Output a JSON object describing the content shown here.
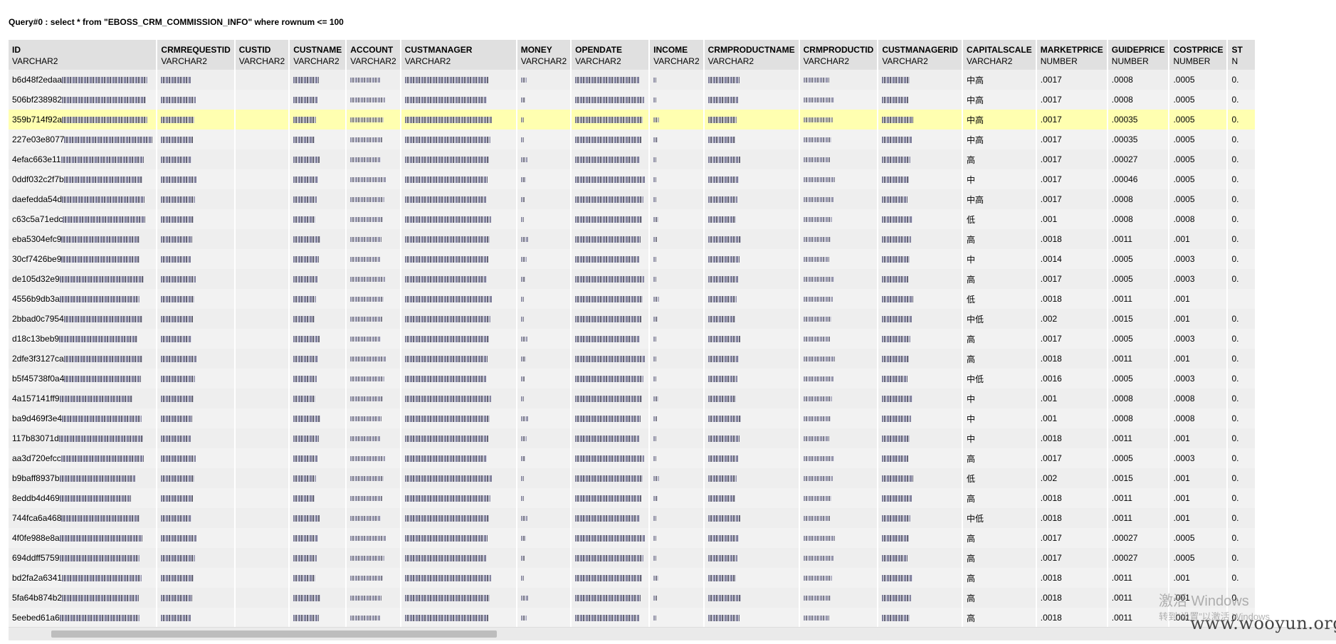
{
  "query_title": "Query#0 : select * from \"EBOSS_CRM_COMMISSION_INFO\" where rownum <= 100",
  "columns": [
    {
      "name": "ID",
      "type": "VARCHAR2"
    },
    {
      "name": "CRMREQUESTID",
      "type": "VARCHAR2"
    },
    {
      "name": "CUSTID",
      "type": "VARCHAR2"
    },
    {
      "name": "CUSTNAME",
      "type": "VARCHAR2"
    },
    {
      "name": "ACCOUNT",
      "type": "VARCHAR2"
    },
    {
      "name": "CUSTMANAGER",
      "type": "VARCHAR2"
    },
    {
      "name": "MONEY",
      "type": "VARCHAR2"
    },
    {
      "name": "OPENDATE",
      "type": "VARCHAR2"
    },
    {
      "name": "INCOME",
      "type": "VARCHAR2"
    },
    {
      "name": "CRMPRODUCTNAME",
      "type": "VARCHAR2"
    },
    {
      "name": "CRMPRODUCTID",
      "type": "VARCHAR2"
    },
    {
      "name": "CUSTMANAGERID",
      "type": "VARCHAR2"
    },
    {
      "name": "CAPITALSCALE",
      "type": "VARCHAR2"
    },
    {
      "name": "MARKETPRICE",
      "type": "NUMBER"
    },
    {
      "name": "GUIDEPRICE",
      "type": "NUMBER"
    },
    {
      "name": "COSTPRICE",
      "type": "NUMBER"
    },
    {
      "name": "ST",
      "type": "N"
    }
  ],
  "rows": [
    {
      "id": "b6d48f2edaa",
      "capitalscale": "中高",
      "marketprice": ".0017",
      "guideprice": ".0008",
      "costprice": ".0005",
      "st": "0."
    },
    {
      "id": "506bf238982",
      "capitalscale": "中高",
      "marketprice": ".0017",
      "guideprice": ".0008",
      "costprice": ".0005",
      "st": "0."
    },
    {
      "id": "359b714f92a",
      "capitalscale": "中高",
      "marketprice": ".0017",
      "guideprice": ".00035",
      "costprice": ".0005",
      "st": "0."
    },
    {
      "id": "227e03e8077",
      "capitalscale": "中高",
      "marketprice": ".0017",
      "guideprice": ".00035",
      "costprice": ".0005",
      "st": "0."
    },
    {
      "id": "4efac663e11",
      "capitalscale": "高",
      "marketprice": ".0017",
      "guideprice": ".00027",
      "costprice": ".0005",
      "st": "0."
    },
    {
      "id": "0ddf032c2f7b",
      "capitalscale": "中",
      "marketprice": ".0017",
      "guideprice": ".00046",
      "costprice": ".0005",
      "st": "0."
    },
    {
      "id": "daefedda54d",
      "capitalscale": "中高",
      "marketprice": ".0017",
      "guideprice": ".0008",
      "costprice": ".0005",
      "st": "0."
    },
    {
      "id": "c63c5a71edc",
      "capitalscale": "低",
      "marketprice": ".001",
      "guideprice": ".0008",
      "costprice": ".0008",
      "st": "0."
    },
    {
      "id": "eba5304efc9",
      "capitalscale": "高",
      "marketprice": ".0018",
      "guideprice": ".0011",
      "costprice": ".001",
      "st": "0."
    },
    {
      "id": "30cf7426be9",
      "capitalscale": "中",
      "marketprice": ".0014",
      "guideprice": ".0005",
      "costprice": ".0003",
      "st": "0."
    },
    {
      "id": "de105d32e9",
      "capitalscale": "高",
      "marketprice": ".0017",
      "guideprice": ".0005",
      "costprice": ".0003",
      "st": "0."
    },
    {
      "id": "4556b9db3a",
      "capitalscale": "低",
      "marketprice": ".0018",
      "guideprice": ".0011",
      "costprice": ".001",
      "st": ""
    },
    {
      "id": "2bbad0c7954",
      "capitalscale": "中低",
      "marketprice": ".002",
      "guideprice": ".0015",
      "costprice": ".001",
      "st": "0."
    },
    {
      "id": "d18c13beb9",
      "capitalscale": "高",
      "marketprice": ".0017",
      "guideprice": ".0005",
      "costprice": ".0003",
      "st": "0."
    },
    {
      "id": "2dfe3f3127ca",
      "capitalscale": "高",
      "marketprice": ".0018",
      "guideprice": ".0011",
      "costprice": ".001",
      "st": "0."
    },
    {
      "id": "b5f45738f0a4",
      "capitalscale": "中低",
      "marketprice": ".0016",
      "guideprice": ".0005",
      "costprice": ".0003",
      "st": "0."
    },
    {
      "id": "4a157141ff9",
      "capitalscale": "中",
      "marketprice": ".001",
      "guideprice": ".0008",
      "costprice": ".0008",
      "st": "0."
    },
    {
      "id": "ba9d469f3e4",
      "capitalscale": "中",
      "marketprice": ".001",
      "guideprice": ".0008",
      "costprice": ".0008",
      "st": "0."
    },
    {
      "id": "117b83071d",
      "capitalscale": "中",
      "marketprice": ".0018",
      "guideprice": ".0011",
      "costprice": ".001",
      "st": "0."
    },
    {
      "id": "aa3d720efcc",
      "capitalscale": "高",
      "marketprice": ".0017",
      "guideprice": ".0005",
      "costprice": ".0003",
      "st": "0."
    },
    {
      "id": "b9baff8937b",
      "capitalscale": "低",
      "marketprice": ".002",
      "guideprice": ".0015",
      "costprice": ".001",
      "st": "0."
    },
    {
      "id": "8eddb4d469",
      "capitalscale": "高",
      "marketprice": ".0018",
      "guideprice": ".0011",
      "costprice": ".001",
      "st": "0."
    },
    {
      "id": "744fca6a468",
      "capitalscale": "中低",
      "marketprice": ".0018",
      "guideprice": ".0011",
      "costprice": ".001",
      "st": "0."
    },
    {
      "id": "4f0fe988e8a",
      "capitalscale": "高",
      "marketprice": ".0017",
      "guideprice": ".00027",
      "costprice": ".0005",
      "st": "0."
    },
    {
      "id": "694ddff5759",
      "capitalscale": "高",
      "marketprice": ".0017",
      "guideprice": ".00027",
      "costprice": ".0005",
      "st": "0."
    },
    {
      "id": "bd2fa2a6341",
      "capitalscale": "高",
      "marketprice": ".0018",
      "guideprice": ".0011",
      "costprice": ".001",
      "st": "0."
    },
    {
      "id": "5fa64b874b2",
      "capitalscale": "高",
      "marketprice": ".0018",
      "guideprice": ".0011",
      "costprice": ".001",
      "st": "0."
    },
    {
      "id": "5eebed61a6",
      "capitalscale": "高",
      "marketprice": ".0018",
      "guideprice": ".0011",
      "costprice": ".001",
      "st": "0."
    }
  ],
  "selected_row_index": 2,
  "colors": {
    "header_bg": "#e0e0e0",
    "row_bg": "#eeeeee",
    "selected_row_bg": "#ffffb0"
  },
  "watermarks": {
    "activate_title": "激活 Windows",
    "activate_sub": "转到“设置”以激活 Windows",
    "site": "www.wooyun.org"
  }
}
